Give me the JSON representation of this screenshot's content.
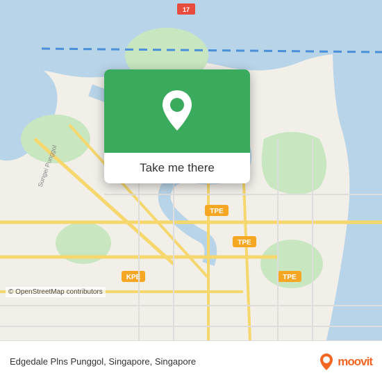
{
  "map": {
    "osm_credit": "© OpenStreetMap contributors"
  },
  "popup": {
    "button_label": "Take me there",
    "green_color": "#3aaa5c"
  },
  "bottom_bar": {
    "location_text": "Edgedale Plns Punggol, Singapore, Singapore",
    "moovit_label": "moovit"
  }
}
